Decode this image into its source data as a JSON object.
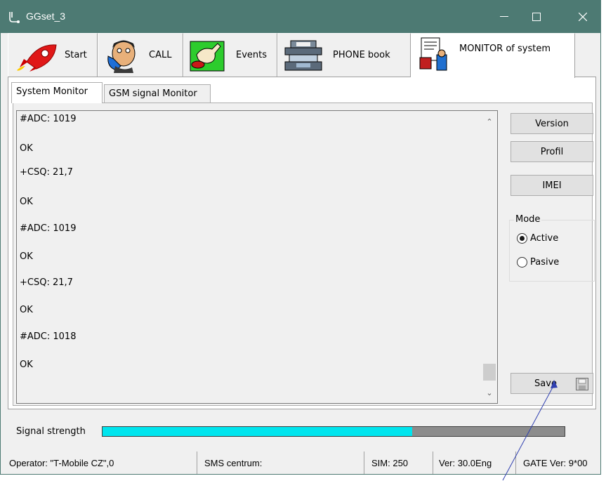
{
  "window": {
    "title": "GGset_3"
  },
  "main_tabs": [
    {
      "label": "Start",
      "icon": "rocket-icon"
    },
    {
      "label": "CALL",
      "icon": "phone-man-icon"
    },
    {
      "label": "Events",
      "icon": "hand-button-icon"
    },
    {
      "label": "PHONE book",
      "icon": "phonebook-icon"
    },
    {
      "label": "MONITOR of system",
      "icon": "monitor-doc-icon"
    }
  ],
  "sub_tabs": [
    {
      "label": "System Monitor"
    },
    {
      "label": "GSM signal Monitor"
    }
  ],
  "log_lines": [
    "#ADC: 1019",
    "OK",
    "+CSQ: 21,7",
    "OK",
    "#ADC: 1019",
    "OK",
    "+CSQ: 21,7",
    "OK",
    "#ADC: 1018",
    "OK"
  ],
  "buttons": {
    "version": "Version",
    "profil": "Profil",
    "imei": "IMEI",
    "save": "Save"
  },
  "mode": {
    "legend": "Mode",
    "options": [
      "Active",
      "Pasive"
    ],
    "selected": "Active"
  },
  "signal": {
    "label": "Signal strength",
    "level_fraction": 0.67,
    "fill_color": "#00e5ee"
  },
  "status_bar": {
    "operator": "Operator: \"T-Mobile CZ\",0",
    "sms_centrum": "SMS centrum:",
    "sim": "SIM: 250",
    "ver": "Ver: 30.0Eng",
    "gate_ver": "GATE Ver: 9*00"
  },
  "colors": {
    "titlebar": "#4d7a73",
    "signal_empty": "#8c8c8c"
  }
}
